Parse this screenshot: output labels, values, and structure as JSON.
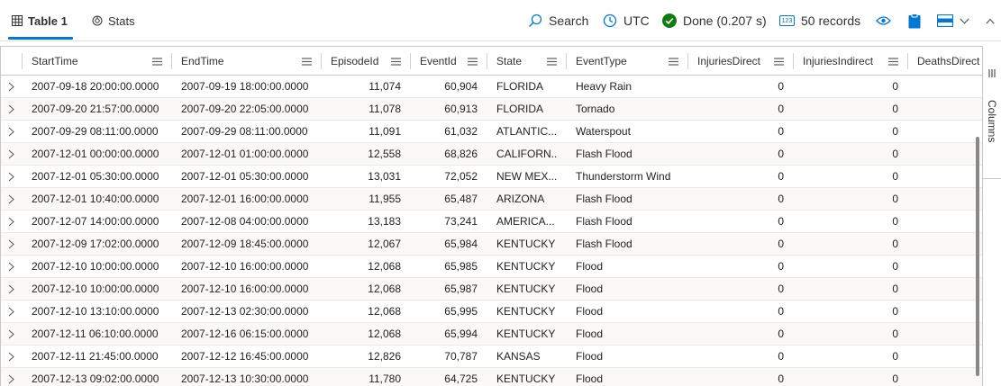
{
  "toolbar": {
    "tabs": [
      {
        "label": "Table 1",
        "active": true
      },
      {
        "label": "Stats",
        "active": false
      }
    ],
    "search_label": "Search",
    "timezone_label": "UTC",
    "status_label": "Done (0.207 s)",
    "records_badge": "123",
    "records_label": "50 records"
  },
  "colors": {
    "accent": "#0078d4",
    "success": "#107c10"
  },
  "grid": {
    "columns": [
      "StartTime",
      "EndTime",
      "EpisodeId",
      "EventId",
      "State",
      "EventType",
      "InjuriesDirect",
      "InjuriesIndirect",
      "DeathsDirect"
    ],
    "rows": [
      [
        "2007-09-18 20:00:00.0000",
        "2007-09-19 18:00:00.0000",
        "11,074",
        "60,904",
        "FLORIDA",
        "Heavy Rain",
        "0",
        "0"
      ],
      [
        "2007-09-20 21:57:00.0000",
        "2007-09-20 22:05:00.0000",
        "11,078",
        "60,913",
        "FLORIDA",
        "Tornado",
        "0",
        "0"
      ],
      [
        "2007-09-29 08:11:00.0000",
        "2007-09-29 08:11:00.0000",
        "11,091",
        "61,032",
        "ATLANTIC...",
        "Waterspout",
        "0",
        "0"
      ],
      [
        "2007-12-01 00:00:00.0000",
        "2007-12-01 01:00:00.0000",
        "12,558",
        "68,826",
        "CALIFORN...",
        "Flash Flood",
        "0",
        "0"
      ],
      [
        "2007-12-01 05:30:00.0000",
        "2007-12-01 05:30:00.0000",
        "13,031",
        "72,052",
        "NEW MEX...",
        "Thunderstorm Wind",
        "0",
        "0"
      ],
      [
        "2007-12-01 10:40:00.0000",
        "2007-12-01 16:00:00.0000",
        "11,955",
        "65,487",
        "ARIZONA",
        "Flash Flood",
        "0",
        "0"
      ],
      [
        "2007-12-07 14:00:00.0000",
        "2007-12-08 04:00:00.0000",
        "13,183",
        "73,241",
        "AMERICA...",
        "Flash Flood",
        "0",
        "0"
      ],
      [
        "2007-12-09 17:02:00.0000",
        "2007-12-09 18:45:00.0000",
        "12,067",
        "65,984",
        "KENTUCKY",
        "Flash Flood",
        "0",
        "0"
      ],
      [
        "2007-12-10 10:00:00.0000",
        "2007-12-10 16:00:00.0000",
        "12,068",
        "65,985",
        "KENTUCKY",
        "Flood",
        "0",
        "0"
      ],
      [
        "2007-12-10 10:00:00.0000",
        "2007-12-10 16:00:00.0000",
        "12,068",
        "65,987",
        "KENTUCKY",
        "Flood",
        "0",
        "0"
      ],
      [
        "2007-12-10 13:10:00.0000",
        "2007-12-13 02:30:00.0000",
        "12,068",
        "65,995",
        "KENTUCKY",
        "Flood",
        "0",
        "0"
      ],
      [
        "2007-12-11 06:10:00.0000",
        "2007-12-16 06:15:00.0000",
        "12,068",
        "65,994",
        "KENTUCKY",
        "Flood",
        "0",
        "0"
      ],
      [
        "2007-12-11 21:45:00.0000",
        "2007-12-12 16:45:00.0000",
        "12,826",
        "70,787",
        "KANSAS",
        "Flood",
        "0",
        "0"
      ],
      [
        "2007-12-13 09:02:00.0000",
        "2007-12-13 10:30:00.0000",
        "11,780",
        "64,725",
        "KENTUCKY",
        "Flood",
        "0",
        "0"
      ]
    ]
  },
  "sidepanel": {
    "columns_label": "Columns"
  }
}
